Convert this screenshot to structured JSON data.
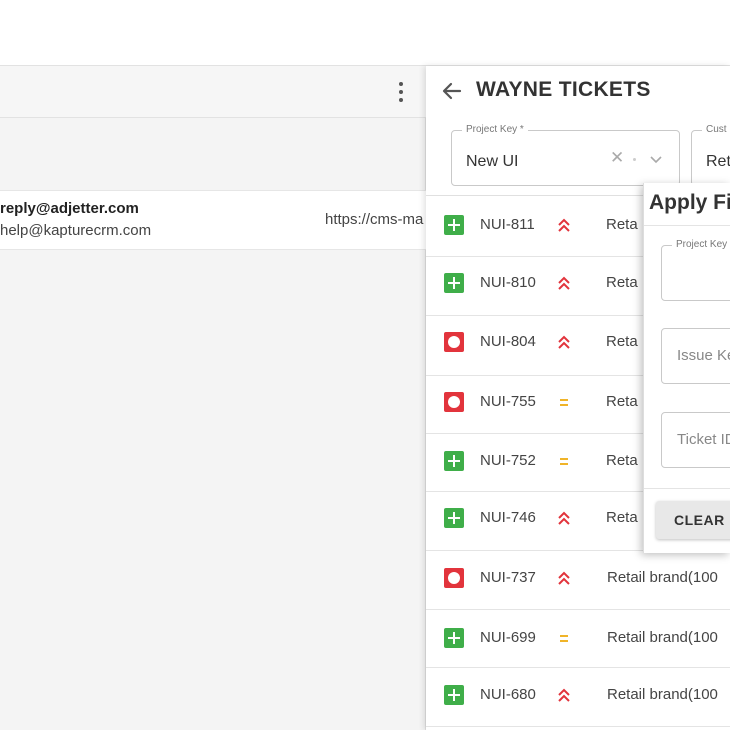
{
  "left_panel": {
    "email": {
      "from": "reply@adjetter.com",
      "to": "help@kapturecrm.com",
      "url": "https://cms-ma"
    }
  },
  "right_panel": {
    "title": "WAYNE TICKETS",
    "project_key": {
      "label": "Project Key *",
      "value": "New UI"
    },
    "customer": {
      "label": "Cust",
      "value": "Ret"
    },
    "tickets": [
      {
        "id": "NUI-811",
        "type": "story",
        "priority": "high",
        "brand": "Reta"
      },
      {
        "id": "NUI-810",
        "type": "story",
        "priority": "high",
        "brand": "Reta"
      },
      {
        "id": "NUI-804",
        "type": "bug",
        "priority": "high",
        "brand": "Reta"
      },
      {
        "id": "NUI-755",
        "type": "bug",
        "priority": "medium",
        "brand": "Reta"
      },
      {
        "id": "NUI-752",
        "type": "story",
        "priority": "medium",
        "brand": "Reta"
      },
      {
        "id": "NUI-746",
        "type": "story",
        "priority": "high",
        "brand": "Reta"
      },
      {
        "id": "NUI-737",
        "type": "bug",
        "priority": "high",
        "brand": "Retail brand(100"
      },
      {
        "id": "NUI-699",
        "type": "story",
        "priority": "medium",
        "brand": "Retail brand(100"
      },
      {
        "id": "NUI-680",
        "type": "story",
        "priority": "high",
        "brand": "Retail brand(100"
      }
    ]
  },
  "filter_popup": {
    "title": "Apply Fi",
    "project_key_label": "Project Key",
    "issue_key_placeholder": "Issue Ke",
    "ticket_id_placeholder": "Ticket ID",
    "clear_label": "CLEAR"
  },
  "colors": {
    "story": "#3fae49",
    "bug": "#e2343c",
    "priority_high": "#e2343c",
    "priority_medium": "#f0b429"
  }
}
